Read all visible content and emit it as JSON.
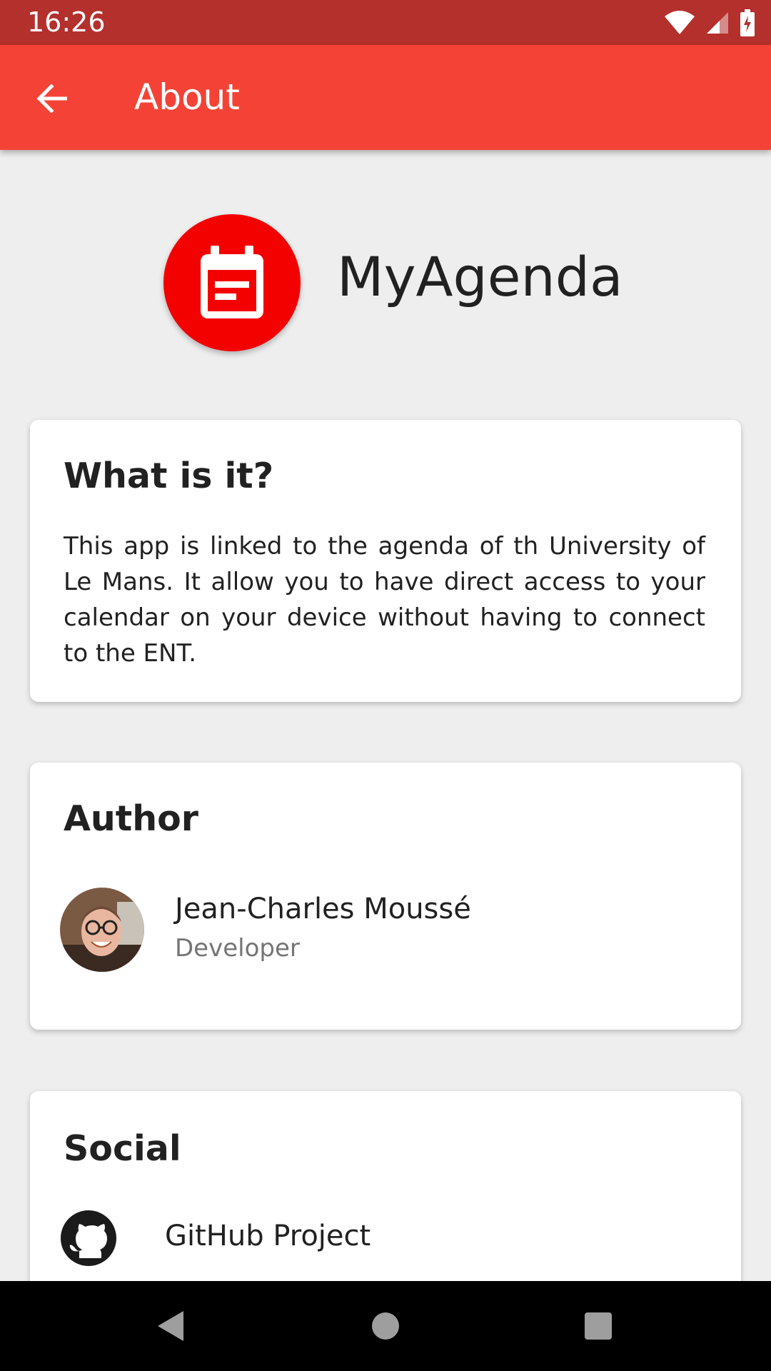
{
  "status_bar": {
    "time": "16:26",
    "icons": [
      "wifi-icon",
      "cell-signal-icon",
      "battery-charging-icon"
    ]
  },
  "toolbar": {
    "back_icon": "arrow-back-icon",
    "title": "About"
  },
  "app": {
    "icon": "calendar-icon",
    "name": "MyAgenda",
    "brand_color": "#f30000"
  },
  "about_card": {
    "title": "What is it?",
    "description": "This app is linked to the agenda of th University of Le Mans. It allow you to have direct access to your calendar on your device without having to connect to the ENT."
  },
  "author_card": {
    "title": "Author",
    "author": {
      "name": "Jean-Charles Moussé",
      "role": "Developer"
    }
  },
  "social_card": {
    "title": "Social",
    "items": [
      {
        "icon": "github-icon",
        "label": "GitHub Project"
      }
    ]
  },
  "nav_bar": {
    "buttons": [
      "back-triangle-icon",
      "home-circle-icon",
      "recents-square-icon"
    ]
  },
  "colors": {
    "status_bar": "#b3302c",
    "toolbar": "#f44336",
    "background": "#eeeeee"
  }
}
